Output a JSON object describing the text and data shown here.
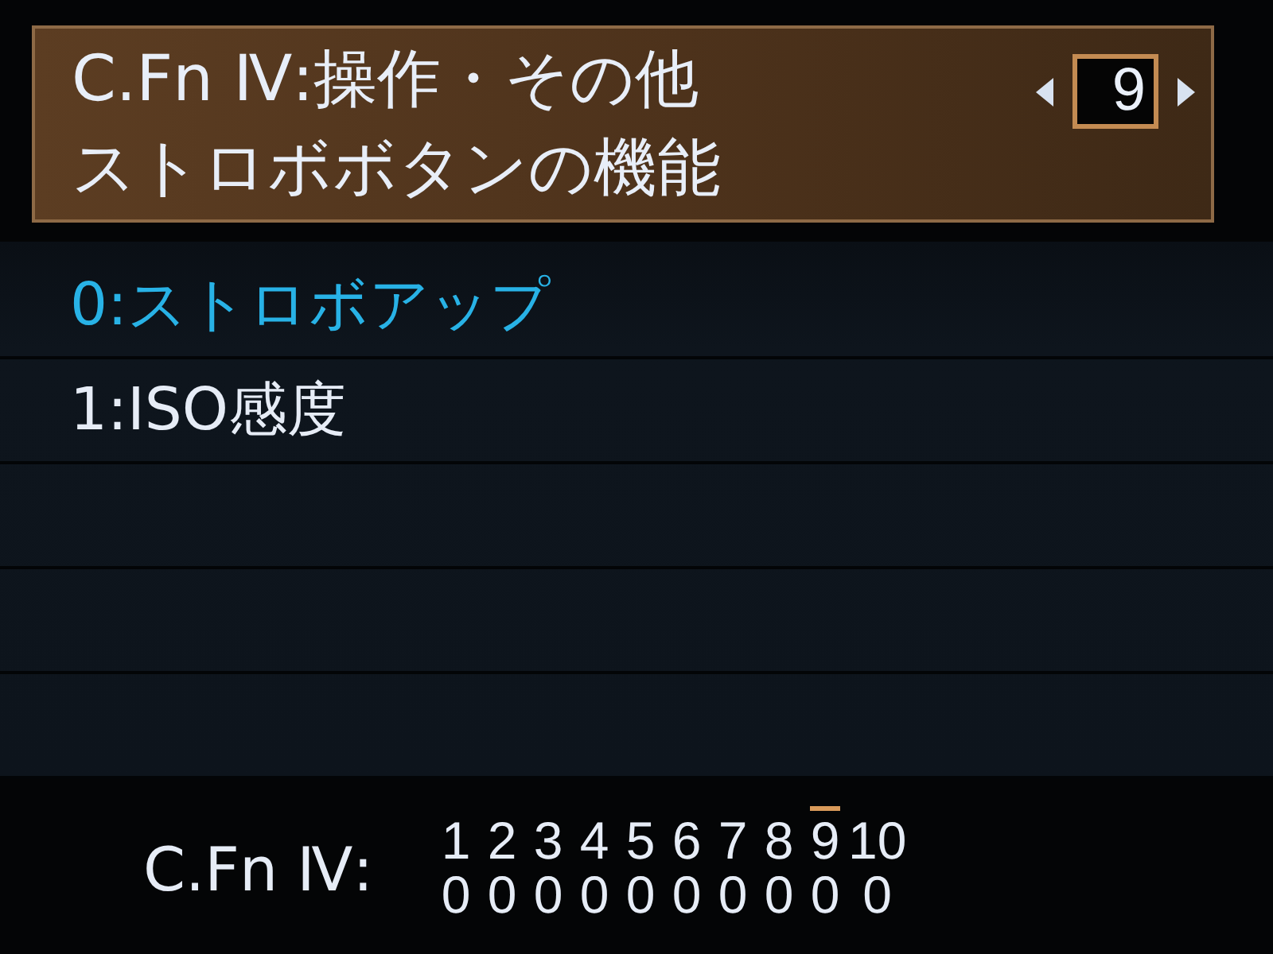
{
  "header": {
    "title": "C.Fn Ⅳ:操作・その他",
    "subtitle": "ストロボボタンの機能",
    "number": "9"
  },
  "options": [
    {
      "label": "0:ストロボアップ",
      "selected": true
    },
    {
      "label": "1:ISO感度",
      "selected": false
    }
  ],
  "summary": {
    "label": "C.Fn Ⅳ:",
    "items": [
      {
        "number": "1",
        "value": "0",
        "selected": false
      },
      {
        "number": "2",
        "value": "0",
        "selected": false
      },
      {
        "number": "3",
        "value": "0",
        "selected": false
      },
      {
        "number": "4",
        "value": "0",
        "selected": false
      },
      {
        "number": "5",
        "value": "0",
        "selected": false
      },
      {
        "number": "6",
        "value": "0",
        "selected": false
      },
      {
        "number": "7",
        "value": "0",
        "selected": false
      },
      {
        "number": "8",
        "value": "0",
        "selected": false
      },
      {
        "number": "9",
        "value": "0",
        "selected": true
      },
      {
        "number": "10",
        "value": "0",
        "selected": false
      }
    ]
  }
}
